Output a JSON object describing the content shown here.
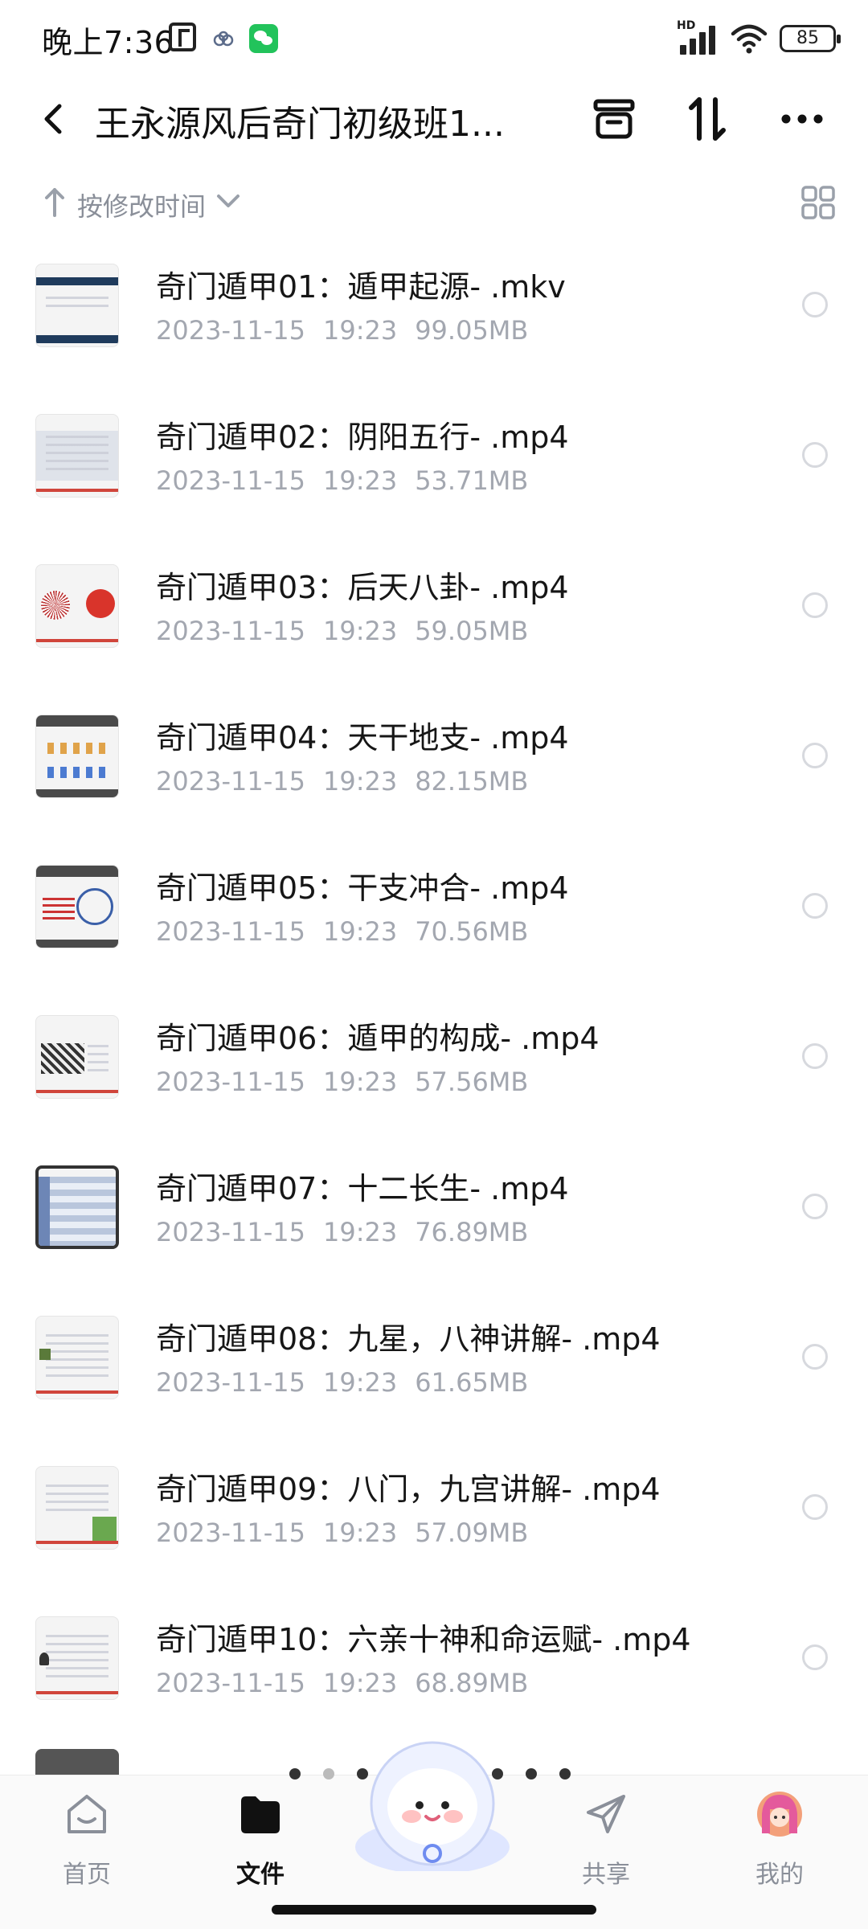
{
  "status_bar": {
    "time": "晚上7:36",
    "battery": "85",
    "network": "HD"
  },
  "header": {
    "title": "王永源风后奇门初级班1..."
  },
  "sort": {
    "label": "按修改时间"
  },
  "files": [
    {
      "name": "奇门遁甲01：遁甲起源-  .mkv",
      "date": "2023-11-15",
      "time": "19:23",
      "size": "99.05MB"
    },
    {
      "name": "奇门遁甲02：阴阳五行-  .mp4",
      "date": "2023-11-15",
      "time": "19:23",
      "size": "53.71MB"
    },
    {
      "name": "奇门遁甲03：后天八卦-  .mp4",
      "date": "2023-11-15",
      "time": "19:23",
      "size": "59.05MB"
    },
    {
      "name": "奇门遁甲04：天干地支-  .mp4",
      "date": "2023-11-15",
      "time": "19:23",
      "size": "82.15MB"
    },
    {
      "name": "奇门遁甲05：干支冲合-  .mp4",
      "date": "2023-11-15",
      "time": "19:23",
      "size": "70.56MB"
    },
    {
      "name": "奇门遁甲06：遁甲的构成-  .mp4",
      "date": "2023-11-15",
      "time": "19:23",
      "size": "57.56MB"
    },
    {
      "name": "奇门遁甲07：十二长生-  .mp4",
      "date": "2023-11-15",
      "time": "19:23",
      "size": "76.89MB"
    },
    {
      "name": "奇门遁甲08：九星，八神讲解-  .mp4",
      "date": "2023-11-15",
      "time": "19:23",
      "size": "61.65MB"
    },
    {
      "name": "奇门遁甲09：八门，九宫讲解-  .mp4",
      "date": "2023-11-15",
      "time": "19:23",
      "size": "57.09MB"
    },
    {
      "name": "奇门遁甲10：六亲十神和命运赋-  .mp4",
      "date": "2023-11-15",
      "time": "19:23",
      "size": "68.89MB"
    }
  ],
  "bottom_nav": {
    "home": "首页",
    "files": "文件",
    "share": "共享",
    "mine": "我的"
  },
  "colors": {
    "accent": "#111111",
    "muted": "#a3a7b0",
    "label": "#8a8f99"
  }
}
